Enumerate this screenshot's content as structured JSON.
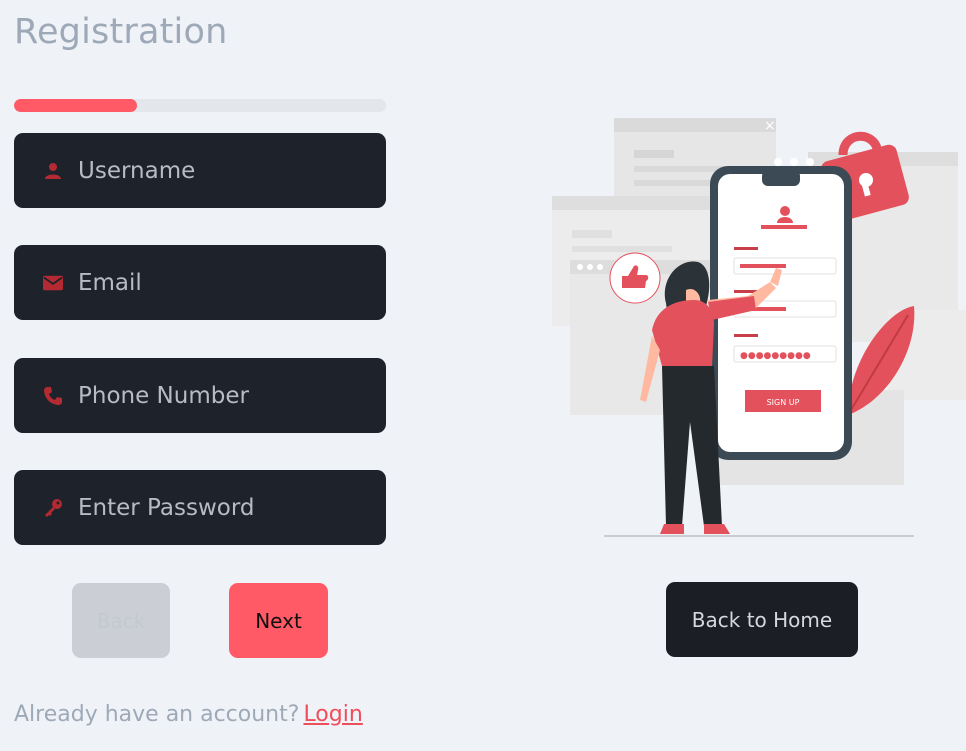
{
  "page": {
    "title": "Registration"
  },
  "progress": {
    "value_fraction": 0.33
  },
  "fields": {
    "username": {
      "placeholder": "Username",
      "icon": "user-icon"
    },
    "email": {
      "placeholder": "Email",
      "icon": "envelope-icon"
    },
    "phone": {
      "placeholder": "Phone Number",
      "icon": "phone-icon"
    },
    "password": {
      "placeholder": "Enter Password",
      "icon": "key-icon"
    }
  },
  "buttons": {
    "back": "Back",
    "next": "Next",
    "home": "Back to Home"
  },
  "footer": {
    "text": "Already have an account?",
    "link": "Login"
  },
  "illustration": {
    "signup_label": "SIGN UP",
    "password_dots": "●●●●●●●●●"
  },
  "colors": {
    "accent": "#ff5a65",
    "field_bg": "#1d222b",
    "page_bg": "#eff2f7",
    "icon": "#b42a32"
  }
}
